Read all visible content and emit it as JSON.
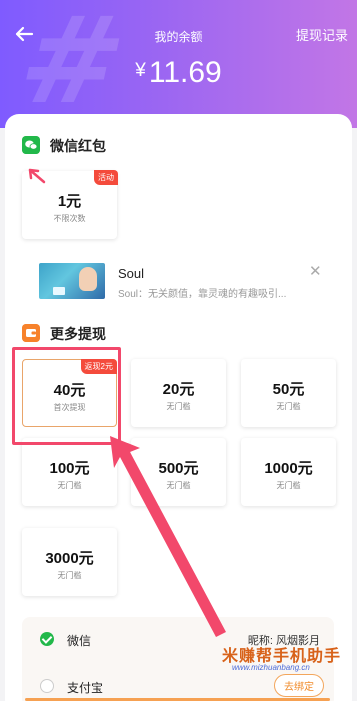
{
  "header": {
    "title": "我的余额",
    "history_label": "提现记录",
    "currency": "¥",
    "balance": "11.69",
    "back_icon": "arrow-left-icon"
  },
  "wechat_section": {
    "title": "微信红包",
    "icon": "wechat-icon",
    "option": {
      "amount": "1元",
      "sub": "不限次数",
      "badge": "活动"
    }
  },
  "ad": {
    "name": "Soul",
    "description": "Soul：无关颜值，靠灵魂的有趣吸引...",
    "close_icon": "close-icon"
  },
  "more_section": {
    "title": "更多提现",
    "icon": "wallet-icon",
    "options": [
      {
        "amount": "40元",
        "sub": "首次提现",
        "badge": "返现2元"
      },
      {
        "amount": "20元",
        "sub": "无门槛"
      },
      {
        "amount": "50元",
        "sub": "无门槛"
      },
      {
        "amount": "100元",
        "sub": "无门槛"
      },
      {
        "amount": "500元",
        "sub": "无门槛"
      },
      {
        "amount": "1000元",
        "sub": "无门槛"
      },
      {
        "amount": "3000元",
        "sub": "无门槛"
      }
    ]
  },
  "payment": {
    "wechat_label": "微信",
    "nickname": "昵称: 风烟影月",
    "alipay_label": "支付宝",
    "bind_label": "去绑定"
  },
  "watermark": {
    "text": "米赚帮手机助手",
    "url": "www.mizhuanbang.cn"
  },
  "colors": {
    "header_start": "#7f5bff",
    "header_end": "#c276e6",
    "highlight": "#f2486b",
    "badge": "#f44b3c",
    "wechat_green": "#22b84a",
    "accent_orange": "#f08b2a"
  }
}
